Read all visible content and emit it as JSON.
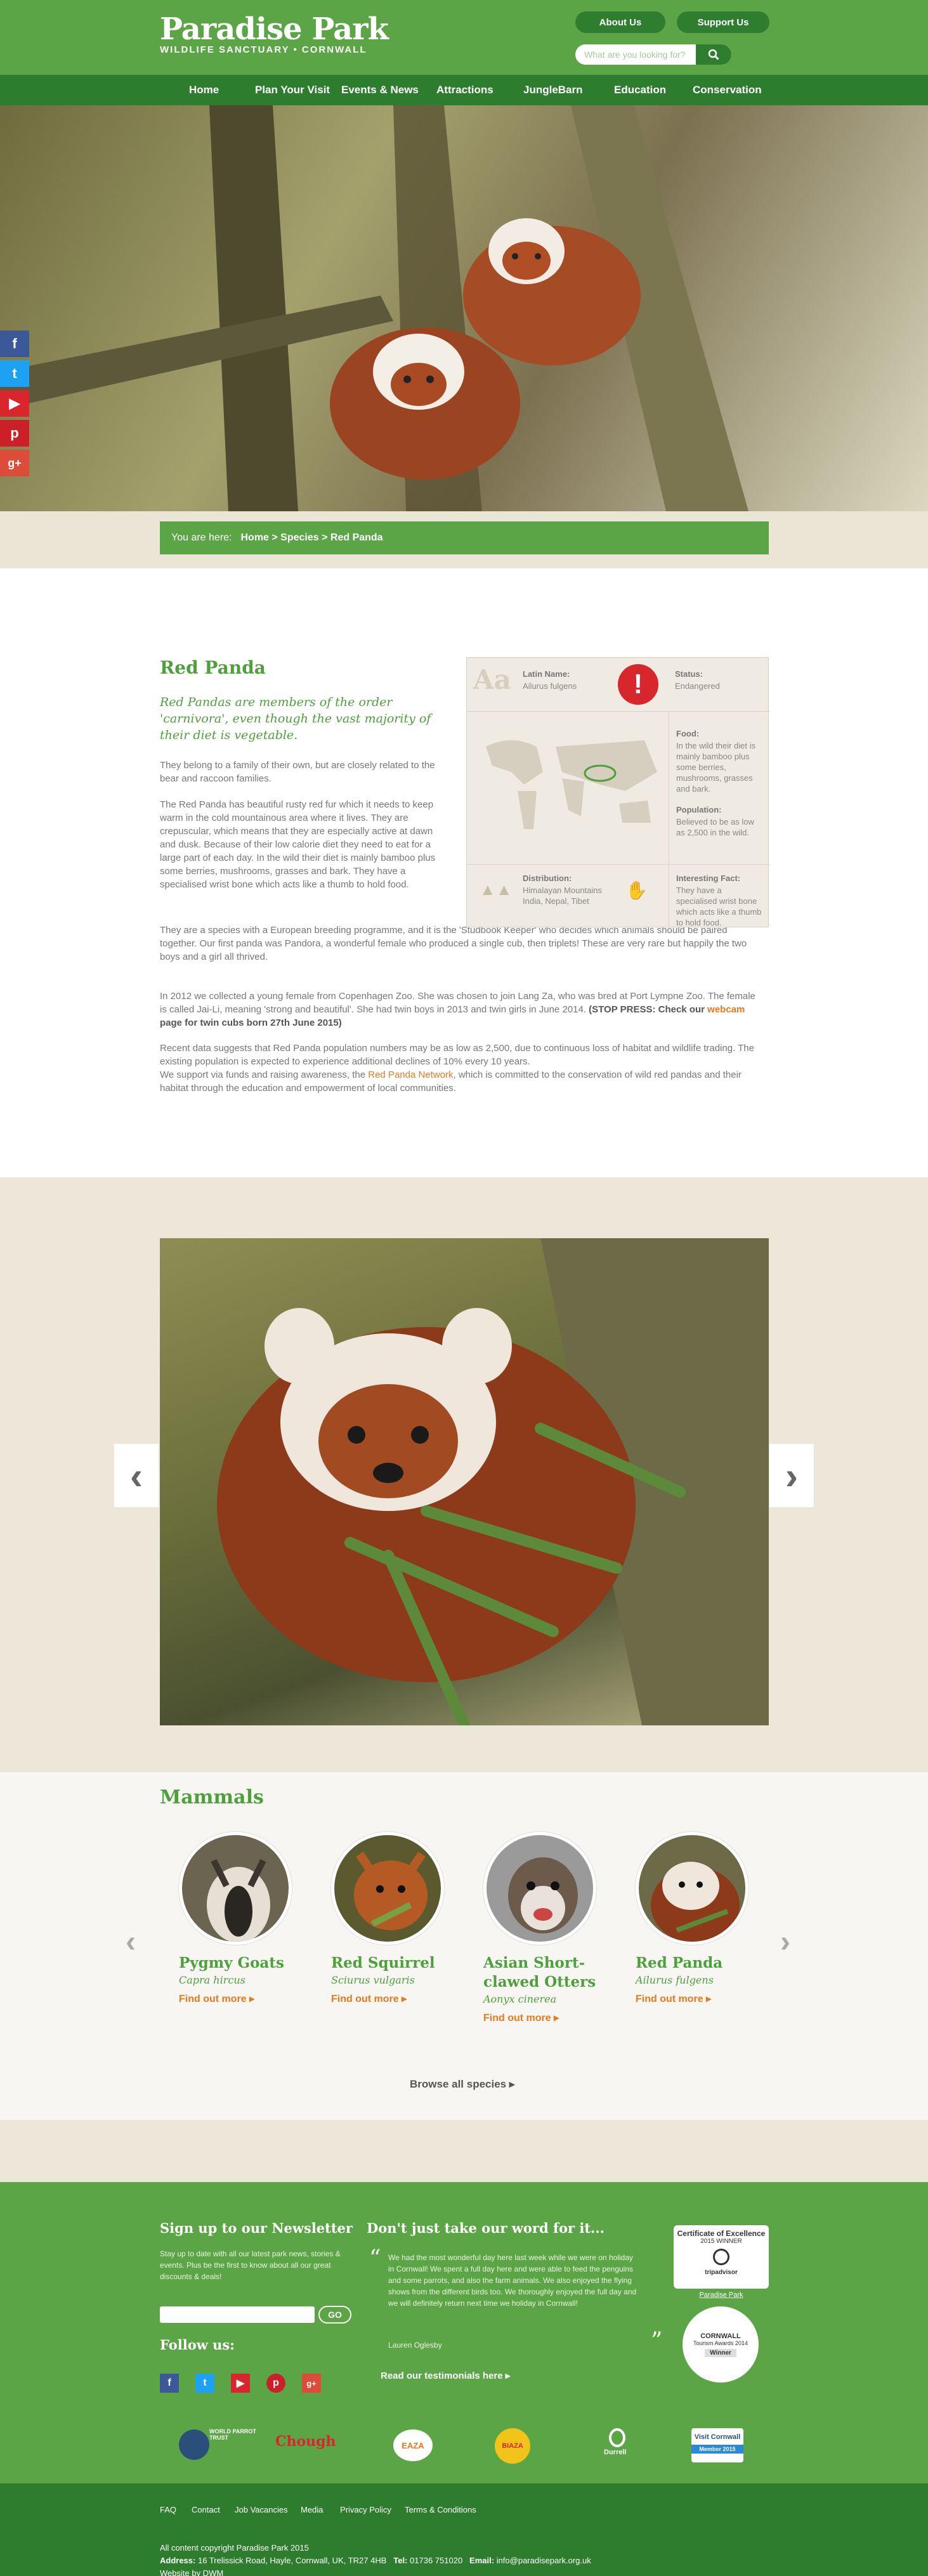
{
  "header": {
    "logo_title": "Paradise Park",
    "logo_subtitle": "WILDLIFE SANCTUARY • CORNWALL",
    "about_label": "About Us",
    "support_label": "Support Us",
    "search_placeholder": "What are you looking for?"
  },
  "nav": [
    "Home",
    "Plan Your Visit",
    "Events & News",
    "Attractions",
    "JungleBarn",
    "Education",
    "Conservation"
  ],
  "breadcrumb": {
    "prefix": "You are here:",
    "path": "Home > Species > Red Panda"
  },
  "species": {
    "title": "Red Panda",
    "intro": "Red Pandas are members of the order 'carnivora', even though the vast majority of their diet is vegetable.",
    "p1": "They belong to a family of their own, but are closely related to the bear and raccoon families.",
    "p2": "The Red Panda has beautiful rusty red fur which it needs to keep warm in the cold mountainous area where it lives. They are crepuscular, which means that they are especially active at dawn and dusk. Because of their low calorie diet they need to eat for a large part of each day. In the wild their diet is mainly bamboo plus some berries, mushrooms, grasses and bark. They have a specialised wrist bone which acts like a thumb to hold food.",
    "p3": "They are a species with a European breeding programme, and it is the 'Studbook Keeper' who decides which animals should be paired together. Our first panda was Pandora, a wonderful female who produced a single cub, then triplets! These are very rare but happily the two boys and a girl all thrived.",
    "p4": "In 2012 we collected a young female from Copenhagen Zoo. She was chosen to join Lang Za, who was bred at Port Lympne Zoo. The female is called Jai-Li, meaning 'strong and beautiful'. She had twin boys in 2013 and twin girls in June 2014.",
    "p4_bold": "(STOP PRESS: Check our",
    "p4_link": "webcam",
    "p4_tail": "page for twin cubs born 27th June 2015)",
    "p5": "Recent data suggests that Red Panda population numbers may be as low as 2,500, due to continuous loss of habitat and wildlife trading. The existing population is expected to experience additional declines of 10% every 10 years.",
    "p6a": "We support via funds and raising awareness, the",
    "p6_link": "Red Panda Network",
    "p6b": ", which is committed to the conservation of wild red pandas and their habitat through the education and empowerment of local communities."
  },
  "facts": {
    "latin_label": "Latin Name:",
    "latin_value": "Ailurus fulgens",
    "status_label": "Status:",
    "status_value": "Endangered",
    "food_label": "Food:",
    "food_value": "In the wild their diet is mainly bamboo plus some berries, mushrooms, grasses and bark.",
    "population_label": "Population:",
    "population_value": "Believed to be as low as 2,500 in the wild.",
    "distribution_label": "Distribution:",
    "distribution_value": "Himalayan Mountains India, Nepal, Tibet",
    "interesting_label": "Interesting Fact:",
    "interesting_value": "They have a specialised wrist bone which acts like a thumb to hold food."
  },
  "mammals": {
    "title": "Mammals",
    "cards": [
      {
        "name": "Pygmy Goats",
        "latin": "Capra hircus",
        "more": "Find out more"
      },
      {
        "name": "Red Squirrel",
        "latin": "Sciurus vulgaris",
        "more": "Find out more"
      },
      {
        "name": "Asian Short-clawed Otters",
        "latin": "Aonyx cinerea",
        "more": "Find out more"
      },
      {
        "name": "Red Panda",
        "latin": "Ailurus fulgens",
        "more": "Find out more"
      }
    ],
    "browse": "Browse all species"
  },
  "footer": {
    "newsletter_title": "Sign up to our Newsletter",
    "newsletter_text": "Stay up to date with all our latest park news, stories & events. Plus be the first to know about all our great discounts & deals!",
    "go": "GO",
    "follow": "Follow us:",
    "testimonial_title": "Don't just take our word for it...",
    "testimonial": "We had the most wonderful day here last week while we were on holiday in Cornwall! We spent a full day here and were able to feed the penguins and some parrots, and also the farm animals. We also enjoyed the flying shows from the different birds too. We thoroughly enjoyed the full day and we will definitely return next time we holiday in Cornwall!",
    "testimonial_author": "Lauren Oglesby",
    "read_more": "Read our testimonials here",
    "cert_title": "Certificate of Excellence",
    "cert_year": "2015 WINNER",
    "cert_brand": "tripadvisor",
    "cert_link": "Paradise Park",
    "award_name": "CORNWALL",
    "award_sub": "Tourism Awards 2014",
    "award_badge": "Winner",
    "partners": [
      "WORLD PARROT TRUST",
      "Chough",
      "EAZA",
      "BIAZA",
      "Durrell",
      "Visit Cornwall"
    ],
    "partner_sub": "Member 2015"
  },
  "bottom": {
    "links": [
      "FAQ",
      "Contact",
      "Job Vacancies",
      "Media",
      "Privacy Policy",
      "Terms & Conditions"
    ],
    "copyright": "All content copyright Paradise Park 2015",
    "address_label": "Address:",
    "address": "16 Trelissick Road, Hayle, Cornwall, UK, TR27 4HB",
    "tel_label": "Tel:",
    "tel": "01736 751020",
    "email_label": "Email:",
    "email": "info@paradisepark.org.uk",
    "credit": "Website by DWM"
  },
  "colors": {
    "brand_green": "#5ca546",
    "dark_green": "#2e7d2e",
    "accent_orange": "#e8791c",
    "status_red": "#d8262d"
  }
}
